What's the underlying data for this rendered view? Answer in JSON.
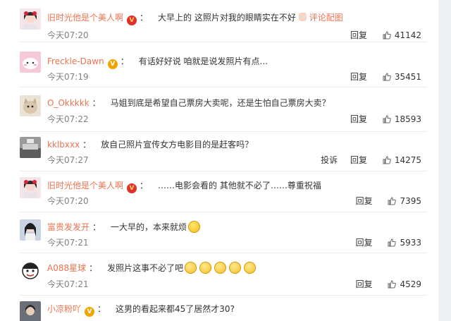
{
  "comments": [
    {
      "user": "旧时光他是个美人啊",
      "badge": "red",
      "text": "大早上的 这照片对我的眼睛实在不好",
      "emoji": "hand",
      "extra": "评论配图",
      "time": "今天07:20",
      "reply": "回复",
      "report": "",
      "likes": "41142",
      "avatar_color": "#f3e6e8"
    },
    {
      "user": "Freckle-Dawn",
      "badge": "gold",
      "text": "有话好好说 咱就是说发照片有点...",
      "time": "今天07:19",
      "reply": "回复",
      "report": "",
      "likes": "35451",
      "avatar_color": "#f6c9d6"
    },
    {
      "user": "O_Okkkkk",
      "badge": "",
      "text": "马姐到底是希望自己票房大卖呢，还是生怕自己票房大卖？",
      "time": "今天07:22",
      "reply": "回复",
      "report": "",
      "likes": "18593",
      "avatar_color": "#d9c6ad"
    },
    {
      "user": "kklbxxx",
      "badge": "",
      "text": "放自己照片宣传女方电影目的是赶客吗？",
      "time": "今天07:27",
      "reply": "回复",
      "report": "投诉",
      "likes": "14275",
      "avatar_color": "#8a8a8a"
    },
    {
      "user": "旧时光他是个美人啊",
      "badge": "red",
      "text": "……电影会看的 其他就不必了……尊重祝福",
      "time": "今天07:20",
      "reply": "回复",
      "report": "",
      "likes": "7395",
      "avatar_color": "#f3e6e8"
    },
    {
      "user": "富贵发发开",
      "badge": "",
      "text": "一大早的，本来就烦",
      "emoji": "smile",
      "time": "今天07:21",
      "reply": "回复",
      "report": "",
      "likes": "5933",
      "avatar_color": "#c9d3e2"
    },
    {
      "user": "A088星球",
      "badge": "",
      "text": "发照片这事不必了吧",
      "emoji_count": "5",
      "time": "今天07:21",
      "reply": "回复",
      "report": "",
      "likes": "4529",
      "avatar_color": "#ffffff"
    },
    {
      "user": "小凉粉吖",
      "badge": "gold",
      "text": "这男的看起来都45了居然才30?",
      "time": "",
      "reply": "",
      "report": "",
      "likes": "",
      "avatar_color": "#6b6f78"
    }
  ],
  "colors": {
    "username": "#eb7350",
    "time": "#808080",
    "text": "#333333"
  }
}
